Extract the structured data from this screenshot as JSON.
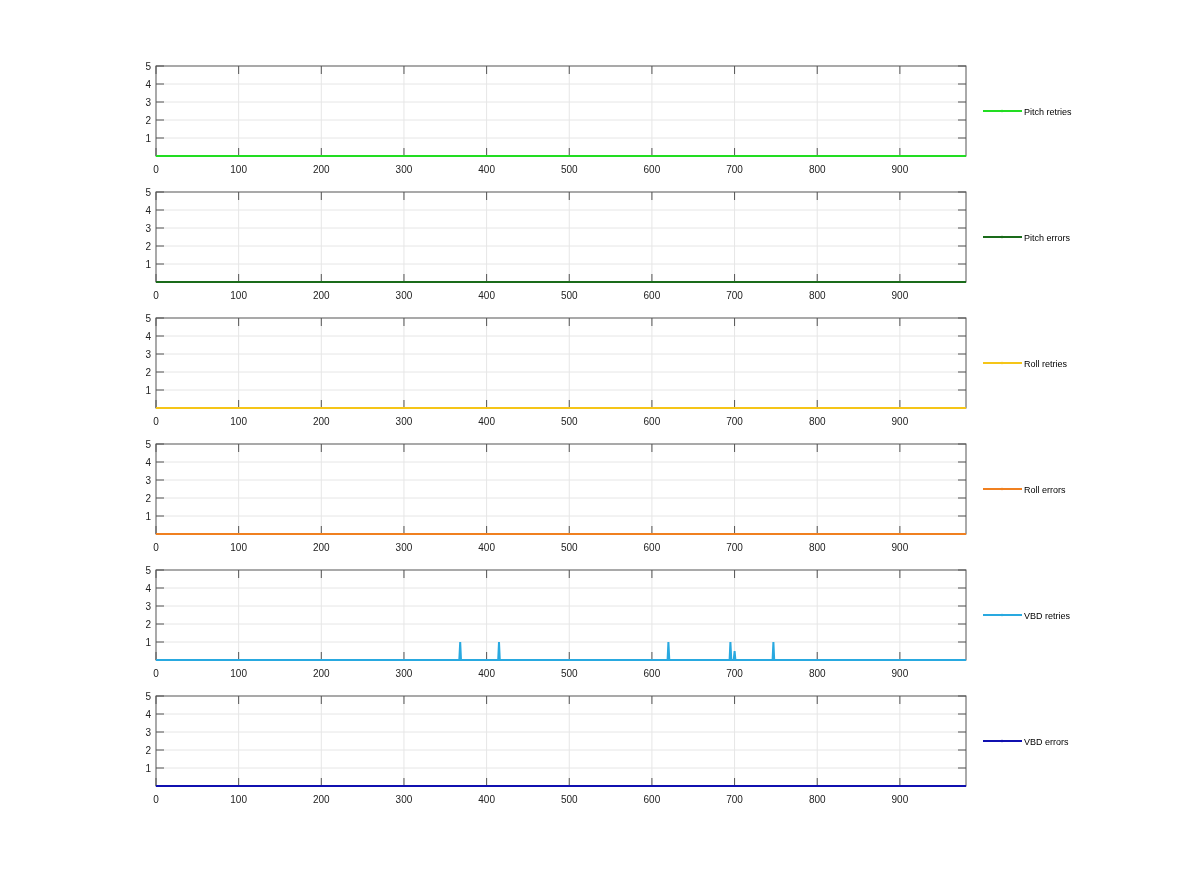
{
  "charts": [
    {
      "chart_data": {
        "type": "line",
        "x": [
          0,
          980
        ],
        "grid": true,
        "series": [
          {
            "name": "Pitch retries",
            "color": "#22dd22",
            "values": [
              0,
              0
            ]
          }
        ],
        "xlim": [
          0,
          980
        ],
        "ylim": [
          0,
          5
        ],
        "xticks": [
          0,
          100,
          200,
          300,
          400,
          500,
          600,
          700,
          800,
          900
        ],
        "yticks": [
          1,
          2,
          3,
          4,
          5
        ]
      }
    },
    {
      "chart_data": {
        "type": "line",
        "x": [
          0,
          980
        ],
        "grid": true,
        "series": [
          {
            "name": "Pitch errors",
            "color": "#1a6b1a",
            "values": [
              0,
              0
            ]
          }
        ],
        "xlim": [
          0,
          980
        ],
        "ylim": [
          0,
          5
        ],
        "xticks": [
          0,
          100,
          200,
          300,
          400,
          500,
          600,
          700,
          800,
          900
        ],
        "yticks": [
          1,
          2,
          3,
          4,
          5
        ]
      }
    },
    {
      "chart_data": {
        "type": "line",
        "x": [
          0,
          980
        ],
        "grid": true,
        "series": [
          {
            "name": "Roll retries",
            "color": "#f5c518",
            "values": [
              0,
              0
            ]
          }
        ],
        "xlim": [
          0,
          980
        ],
        "ylim": [
          0,
          5
        ],
        "xticks": [
          0,
          100,
          200,
          300,
          400,
          500,
          600,
          700,
          800,
          900
        ],
        "yticks": [
          1,
          2,
          3,
          4,
          5
        ]
      }
    },
    {
      "chart_data": {
        "type": "line",
        "x": [
          0,
          980
        ],
        "grid": true,
        "series": [
          {
            "name": "Roll errors",
            "color": "#f08020",
            "values": [
              0,
              0
            ]
          }
        ],
        "xlim": [
          0,
          980
        ],
        "ylim": [
          0,
          5
        ],
        "xticks": [
          0,
          100,
          200,
          300,
          400,
          500,
          600,
          700,
          800,
          900
        ],
        "yticks": [
          1,
          2,
          3,
          4,
          5
        ]
      }
    },
    {
      "chart_data": {
        "type": "line",
        "x": [
          0,
          367,
          368,
          369,
          414,
          415,
          416,
          619,
          620,
          621,
          694,
          695,
          696,
          699,
          700,
          701,
          746,
          747,
          748,
          980
        ],
        "grid": true,
        "series": [
          {
            "name": "VBD retries",
            "color": "#29a9e0",
            "values": [
              0,
              0,
              1,
              0,
              0,
              1,
              0,
              0,
              1,
              0,
              0,
              1,
              0,
              0,
              0.5,
              0,
              0,
              1,
              0,
              0
            ]
          }
        ],
        "xlim": [
          0,
          980
        ],
        "ylim": [
          0,
          5
        ],
        "xticks": [
          0,
          100,
          200,
          300,
          400,
          500,
          600,
          700,
          800,
          900
        ],
        "yticks": [
          1,
          2,
          3,
          4,
          5
        ]
      }
    },
    {
      "chart_data": {
        "type": "line",
        "x": [
          0,
          980
        ],
        "grid": true,
        "series": [
          {
            "name": "VBD errors",
            "color": "#1010b0",
            "values": [
              0,
              0
            ]
          }
        ],
        "xlim": [
          0,
          980
        ],
        "ylim": [
          0,
          5
        ],
        "xticks": [
          0,
          100,
          200,
          300,
          400,
          500,
          600,
          700,
          800,
          900
        ],
        "yticks": [
          1,
          2,
          3,
          4,
          5
        ]
      }
    }
  ]
}
